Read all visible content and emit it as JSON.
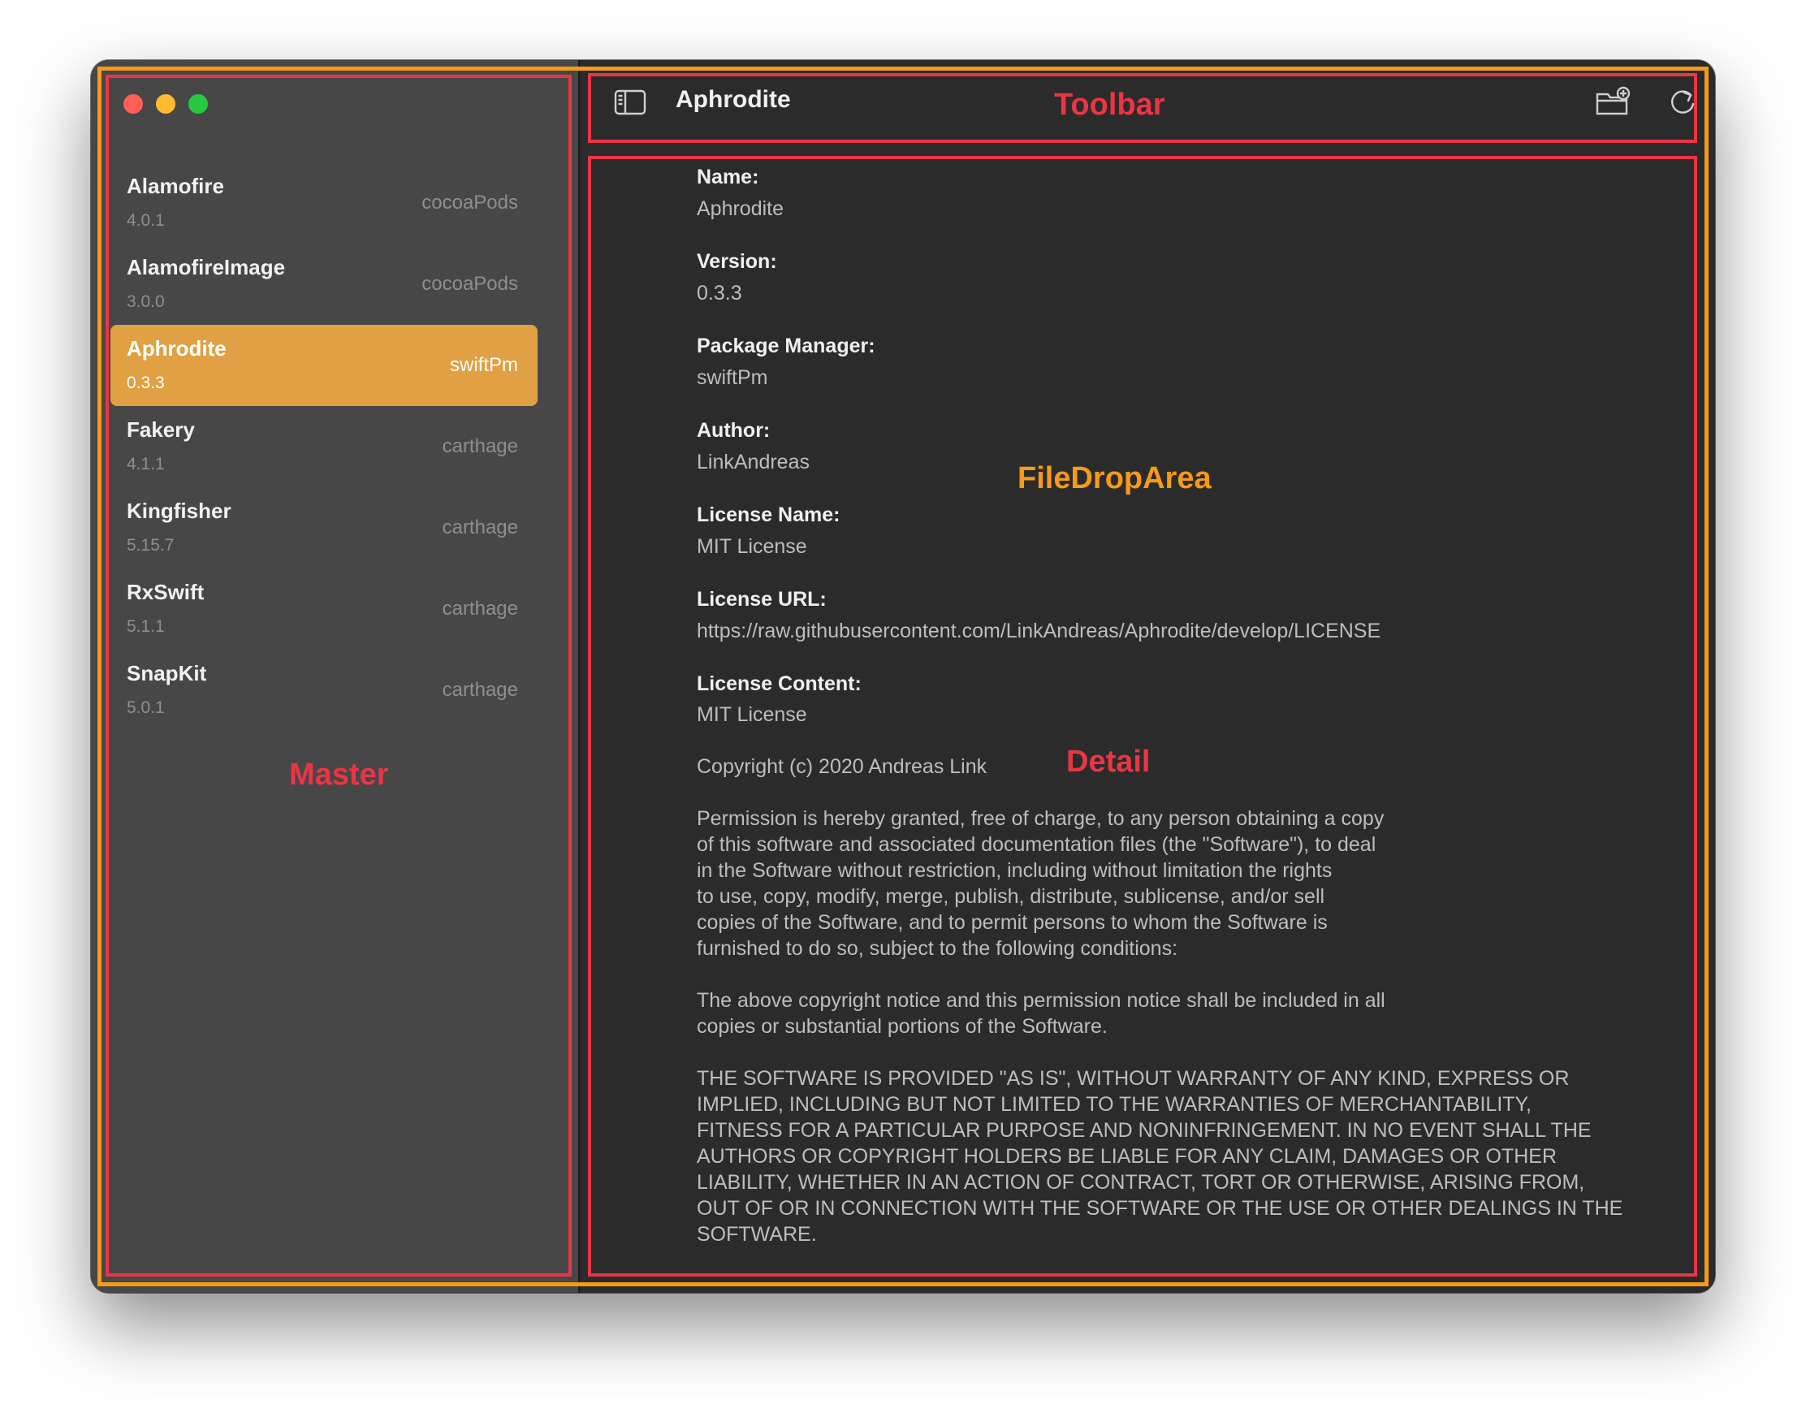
{
  "sidebar": {
    "packages": [
      {
        "name": "Alamofire",
        "version": "4.0.1",
        "manager": "cocoaPods",
        "selected": false
      },
      {
        "name": "AlamofireImage",
        "version": "3.0.0",
        "manager": "cocoaPods",
        "selected": false
      },
      {
        "name": "Aphrodite",
        "version": "0.3.3",
        "manager": "swiftPm",
        "selected": true
      },
      {
        "name": "Fakery",
        "version": "4.1.1",
        "manager": "carthage",
        "selected": false
      },
      {
        "name": "Kingfisher",
        "version": "5.15.7",
        "manager": "carthage",
        "selected": false
      },
      {
        "name": "RxSwift",
        "version": "5.1.1",
        "manager": "carthage",
        "selected": false
      },
      {
        "name": "SnapKit",
        "version": "5.0.1",
        "manager": "carthage",
        "selected": false
      }
    ]
  },
  "toolbar": {
    "title": "Aphrodite",
    "icons": [
      "sidebar-toggle-icon",
      "folder-add-icon",
      "refresh-icon",
      "share-icon"
    ]
  },
  "detail": {
    "name_label": "Name:",
    "name_value": "Aphrodite",
    "version_label": "Version:",
    "version_value": "0.3.3",
    "manager_label": "Package Manager:",
    "manager_value": "swiftPm",
    "author_label": "Author:",
    "author_value": "LinkAndreas",
    "license_name_label": "License Name:",
    "license_name_value": "MIT License",
    "license_url_label": "License URL:",
    "license_url_value": "https://raw.githubusercontent.com/LinkAndreas/Aphrodite/develop/LICENSE",
    "license_content_label": "License Content:",
    "license_content_value": "MIT License\n\nCopyright (c) 2020 Andreas Link\n\nPermission is hereby granted, free of charge, to any person obtaining a copy\nof this software and associated documentation files (the \"Software\"), to deal\nin the Software without restriction, including without limitation the rights\nto use, copy, modify, merge, publish, distribute, sublicense, and/or sell\ncopies of the Software, and to permit persons to whom the Software is\nfurnished to do so, subject to the following conditions:\n\nThe above copyright notice and this permission notice shall be included in all\ncopies or substantial portions of the Software.\n\nTHE SOFTWARE IS PROVIDED \"AS IS\", WITHOUT WARRANTY OF ANY KIND, EXPRESS OR\nIMPLIED, INCLUDING BUT NOT LIMITED TO THE WARRANTIES OF MERCHANTABILITY,\nFITNESS FOR A PARTICULAR PURPOSE AND NONINFRINGEMENT. IN NO EVENT SHALL THE\nAUTHORS OR COPYRIGHT HOLDERS BE LIABLE FOR ANY CLAIM, DAMAGES OR OTHER\nLIABILITY, WHETHER IN AN ACTION OF CONTRACT, TORT OR OTHERWISE, ARISING FROM,\nOUT OF OR IN CONNECTION WITH THE SOFTWARE OR THE USE OR OTHER DEALINGS IN THE\nSOFTWARE."
  },
  "annotations": {
    "toolbar": "Toolbar",
    "file_drop_area": "FileDropArea",
    "detail": "Detail",
    "master": "Master"
  },
  "colors": {
    "selection": "#e0a043",
    "annotation_red": "#ea3545",
    "annotation_orange": "#f59a1a",
    "sidebar_bg": "#474747",
    "main_bg": "#2b2b2b"
  }
}
